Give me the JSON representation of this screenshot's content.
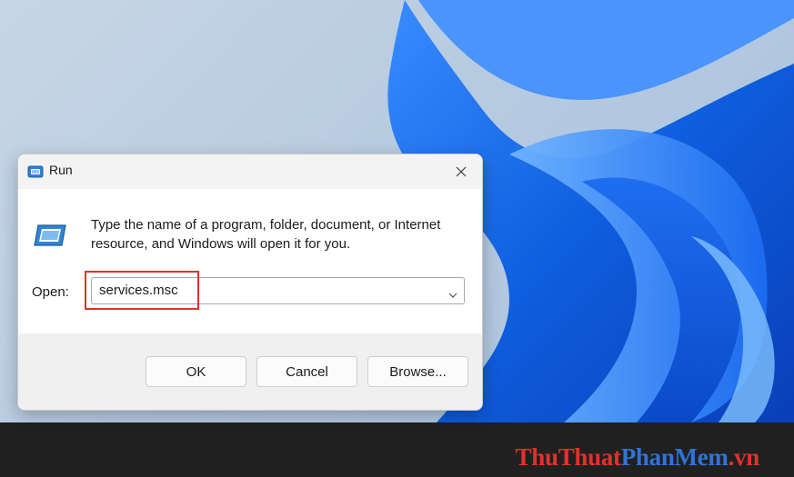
{
  "dialog": {
    "title": "Run",
    "description": "Type the name of a program, folder, document, or Internet resource, and Windows will open it for you.",
    "open_label": "Open:",
    "open_value": "services.msc",
    "buttons": {
      "ok": "OK",
      "cancel": "Cancel",
      "browse": "Browse..."
    }
  },
  "watermark": {
    "part1": "ThuThuat",
    "part2": "PhanMem",
    "part3": ".vn"
  },
  "colors": {
    "highlight": "#e0322b",
    "wallpaper_blue": "#1a6ae8",
    "taskbar": "#202020",
    "watermark_red": "#e0322b",
    "watermark_blue": "#2f73d8"
  },
  "icons": {
    "title": "run-icon",
    "dialog": "run-icon",
    "close": "close-icon",
    "dropdown": "chevron-down-icon"
  }
}
